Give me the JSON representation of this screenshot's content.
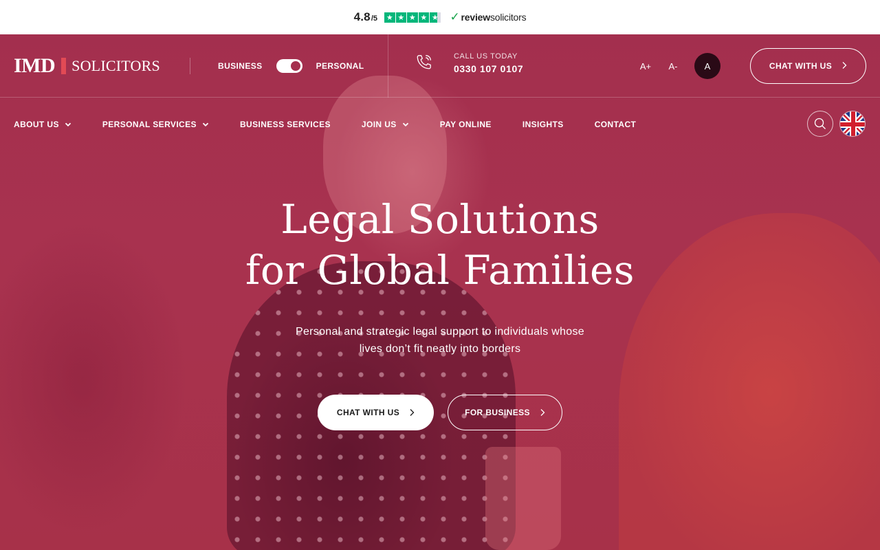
{
  "review_bar": {
    "rating": "4.8",
    "rating_scale": "/5",
    "stars": 4.8,
    "logo_bold": "review",
    "logo_light": "solicitors",
    "star_color": "#00b67a"
  },
  "header": {
    "logo_main": "IMD",
    "logo_sub": "SOLICITORS",
    "toggle": {
      "left_label": "BUSINESS",
      "right_label": "PERSONAL",
      "selected": "PERSONAL"
    },
    "call_label": "CALL US TODAY",
    "phone": "0330 107 0107",
    "font_controls": [
      "A+",
      "A-",
      "A"
    ],
    "chat_label": "CHAT WITH US"
  },
  "nav": {
    "items": [
      {
        "label": "ABOUT US",
        "has_dropdown": true
      },
      {
        "label": "PERSONAL SERVICES",
        "has_dropdown": true
      },
      {
        "label": "BUSINESS SERVICES",
        "has_dropdown": false
      },
      {
        "label": "JOIN US",
        "has_dropdown": true
      },
      {
        "label": "PAY ONLINE",
        "has_dropdown": false
      },
      {
        "label": "INSIGHTS",
        "has_dropdown": false
      },
      {
        "label": "CONTACT",
        "has_dropdown": false
      }
    ],
    "search_icon": "search-icon",
    "language_icon": "uk-flag-icon"
  },
  "hero": {
    "title_line1": "Legal Solutions",
    "title_line2": "for Global Families",
    "subtitle_line1": "Personal and strategic legal support to individuals whose",
    "subtitle_line2": "lives don’t fit neatly into borders",
    "primary_button": "CHAT WITH US",
    "secondary_button": "FOR BUSINESS"
  },
  "colors": {
    "hero_overlay": "#a5304e",
    "brand_accent": "#e24a55",
    "active_font_bg": "#2a0a16"
  }
}
